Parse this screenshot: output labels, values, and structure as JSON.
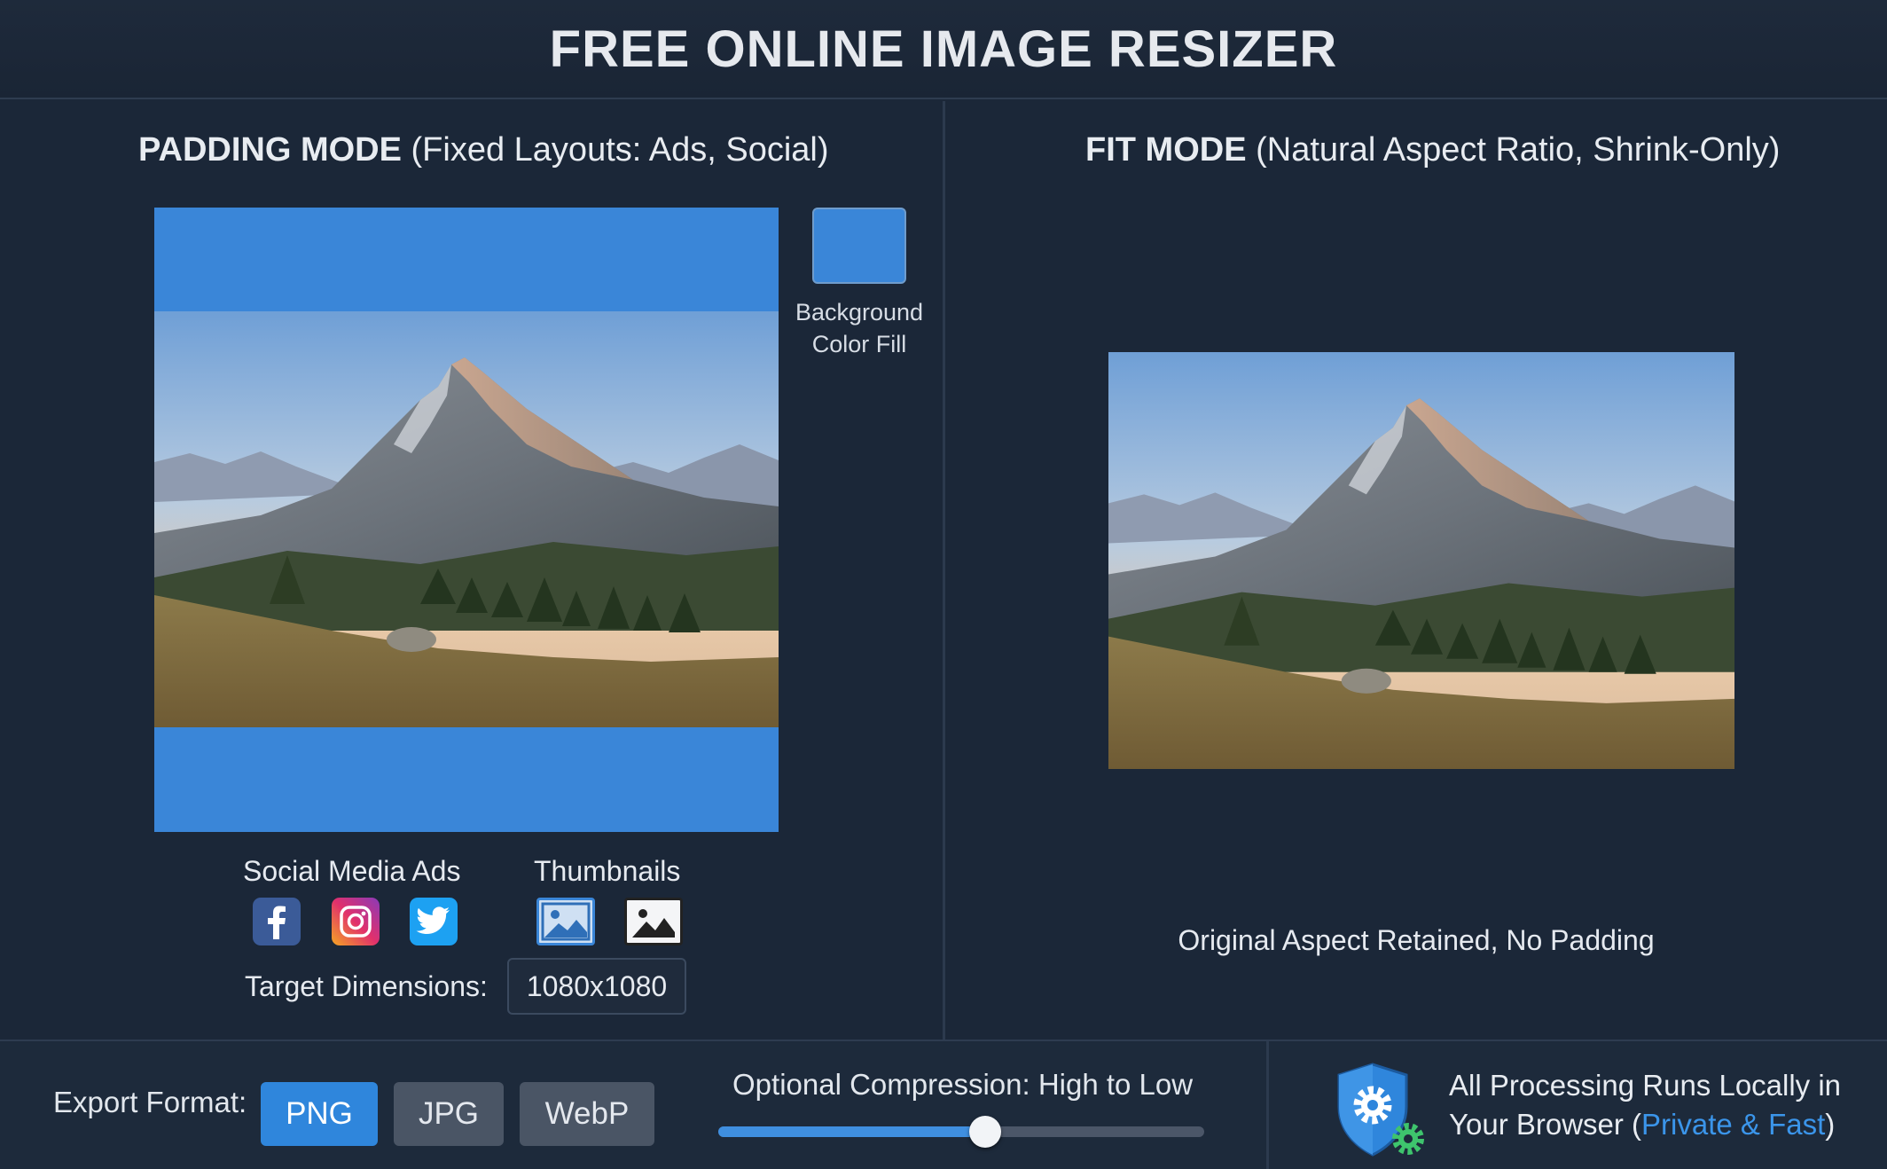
{
  "header": {
    "title": "FREE ONLINE IMAGE RESIZER"
  },
  "padding_panel": {
    "title_bold": "PADDING MODE",
    "title_rest": "(Fixed Layouts: Ads, Social)",
    "background_fill_label_line1": "Background",
    "background_fill_label_line2": "Color Fill",
    "background_color": "#3a86d8",
    "use_cases": {
      "social_label": "Social Media Ads",
      "thumbnails_label": "Thumbnails",
      "social_icons": [
        "facebook-icon",
        "instagram-icon",
        "twitter-icon"
      ],
      "thumbnail_icons": [
        "image-icon",
        "image-outline-icon"
      ]
    },
    "target_label": "Target Dimensions:",
    "target_value": "1080x1080"
  },
  "fit_panel": {
    "title_bold": "FIT MODE",
    "title_rest": "(Natural Aspect Ratio, Shrink-Only)",
    "caption": "Original Aspect Retained, No Padding"
  },
  "bottom_bar": {
    "export_label": "Export Format:",
    "formats": [
      {
        "label": "PNG",
        "active": true
      },
      {
        "label": "JPG",
        "active": false
      },
      {
        "label": "WebP",
        "active": false
      }
    ],
    "compression_label": "Optional Compression: High to Low",
    "compression_level": 0.55,
    "local_line1": "All Processing Runs Locally in",
    "local_line2_prefix": "Your Browser (",
    "local_line2_accent": "Private & Fast",
    "local_line2_suffix": ")",
    "accent_color": "#3b95ea"
  }
}
